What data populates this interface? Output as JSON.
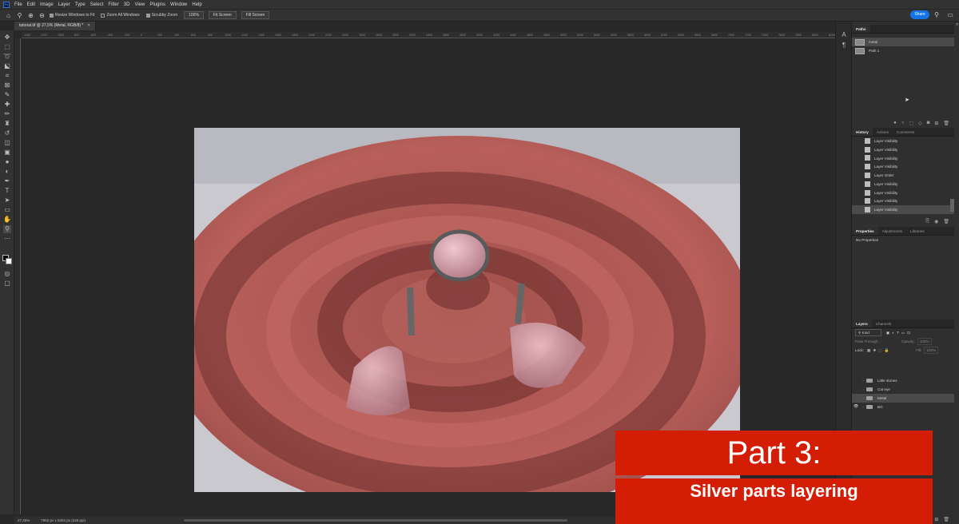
{
  "menubar": {
    "logo": "Ps",
    "items": [
      "File",
      "Edit",
      "Image",
      "Layer",
      "Type",
      "Select",
      "Filter",
      "3D",
      "View",
      "Plugins",
      "Window",
      "Help"
    ]
  },
  "options": {
    "resize_windows": "Resize Windows to Fit",
    "zoom_all": "Zoom All Windows",
    "scrubby_zoom": "Scrubby Zoom",
    "zoom_value": "100%",
    "fit_screen": "Fit Screen",
    "fill_screen": "Fill Screen",
    "share": "Share"
  },
  "document": {
    "tab_title": "tutorial.tif @ 27,5% (Metal, RGB/8) *"
  },
  "ruler_ticks": [
    "-1400",
    "-1200",
    "-1000",
    "-800",
    "-600",
    "-400",
    "-200",
    "0",
    "200",
    "400",
    "600",
    "800",
    "1000",
    "1200",
    "1400",
    "1600",
    "1800",
    "2000",
    "2200",
    "2400",
    "2600",
    "2800",
    "3000",
    "3200",
    "3400",
    "3600",
    "3800",
    "4000",
    "4200",
    "4400",
    "4600",
    "4800",
    "5000",
    "5200",
    "5400",
    "5600",
    "5800",
    "6000",
    "6200",
    "6400",
    "6600",
    "6800",
    "7000",
    "7200",
    "7400",
    "7600",
    "7800",
    "8000",
    "8200",
    "8400"
  ],
  "status": {
    "zoom": "27,45%",
    "size": "7952 px x 5304 px (240 ppi)"
  },
  "paths_panel": {
    "tab": "Paths",
    "items": [
      {
        "label": "metal",
        "selected": true
      },
      {
        "label": "Path 1",
        "selected": false
      }
    ]
  },
  "history_panel": {
    "tabs": [
      "History",
      "Actions",
      "Comments"
    ],
    "items": [
      "Layer Visibility",
      "Layer Visibility",
      "Layer Visibility",
      "Layer Visibility",
      "Layer Order",
      "Layer Visibility",
      "Layer Visibility",
      "Layer Visibility",
      "Layer Visibility"
    ],
    "selected_label": "Layer Visibility"
  },
  "properties_panel": {
    "tabs": [
      "Properties",
      "Adjustments",
      "Libraries"
    ],
    "empty_text": "No Properties"
  },
  "layers_panel": {
    "tabs": [
      "Layers",
      "Channels"
    ],
    "filter_kind": "Kind",
    "blend_mode": "Pass Through",
    "opacity_label": "Opacity:",
    "opacity_value": "100%",
    "lock_label": "Lock:",
    "fill_label": "Fill:",
    "fill_value": "100%",
    "layers": [
      {
        "name": "Little stones",
        "visible": false,
        "selected": false
      },
      {
        "name": "Cat eye",
        "visible": false,
        "selected": false
      },
      {
        "name": "Metal",
        "visible": false,
        "selected": true
      },
      {
        "name": "BG",
        "visible": true,
        "selected": false
      }
    ]
  },
  "overlay": {
    "title": "Part 3:",
    "subtitle": "Silver parts layering"
  },
  "colors": {
    "accent": "#1473e6",
    "overlay_red": "#d41d05",
    "sand": "#b15c58"
  }
}
